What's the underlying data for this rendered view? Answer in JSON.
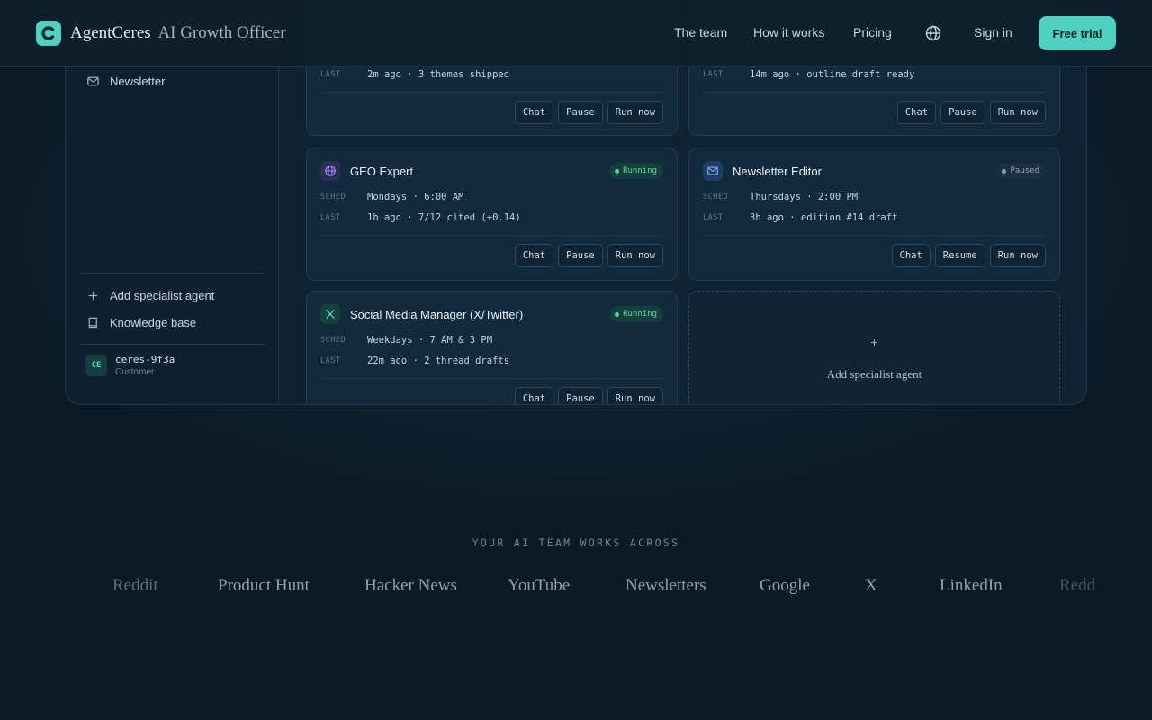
{
  "header": {
    "brand": "AgentCeres",
    "brand_sub": "AI Growth Officer",
    "nav": [
      "The team",
      "How it works",
      "Pricing"
    ],
    "sign_in": "Sign in",
    "cta": "Free trial"
  },
  "sidebar": {
    "items_top": [
      {
        "label": "Newsletter",
        "icon": "mail-icon"
      }
    ],
    "items_bottom": [
      {
        "label": "Add specialist agent",
        "icon": "plus-icon"
      },
      {
        "label": "Knowledge base",
        "icon": "book-icon"
      }
    ],
    "user": {
      "initials": "CE",
      "name": "ceres-9f3a",
      "role": "Customer"
    }
  },
  "labels": {
    "sched": "SCHED",
    "last": "LAST"
  },
  "cards": [
    {
      "last": "2m ago · 3 themes shipped",
      "actions": [
        "Chat",
        "Pause",
        "Run now"
      ]
    },
    {
      "last": "14m ago · outline draft ready",
      "actions": [
        "Chat",
        "Pause",
        "Run now"
      ]
    },
    {
      "name": "GEO Expert",
      "icon": "globe-icon",
      "status": "Running",
      "sched": "Mondays · 6:00 AM",
      "last": "1h ago · 7/12 cited (+0.14)",
      "actions": [
        "Chat",
        "Pause",
        "Run now"
      ]
    },
    {
      "name": "Newsletter Editor",
      "icon": "mail-icon",
      "status": "Paused",
      "sched": "Thursdays · 2:00 PM",
      "last": "3h ago · edition #14 draft",
      "actions": [
        "Chat",
        "Resume",
        "Run now"
      ]
    },
    {
      "name": "Social Media Manager (X/Twitter)",
      "icon": "x-logo-icon",
      "status": "Running",
      "sched": "Weekdays · 7 AM & 3 PM",
      "last": "22m ago · 2 thread drafts",
      "actions": [
        "Chat",
        "Pause",
        "Run now"
      ]
    }
  ],
  "add_card": {
    "plus": "+",
    "label": "Add specialist agent"
  },
  "across": {
    "title": "YOUR AI TEAM WORKS ACROSS",
    "platforms": [
      "Reddit",
      "Product Hunt",
      "Hacker News",
      "YouTube",
      "Newsletters",
      "Google",
      "X",
      "LinkedIn",
      "Reddit"
    ]
  },
  "colors": {
    "accent": "#4fd1c1",
    "running": "#4fd6a0",
    "background": "#0a1a26"
  }
}
